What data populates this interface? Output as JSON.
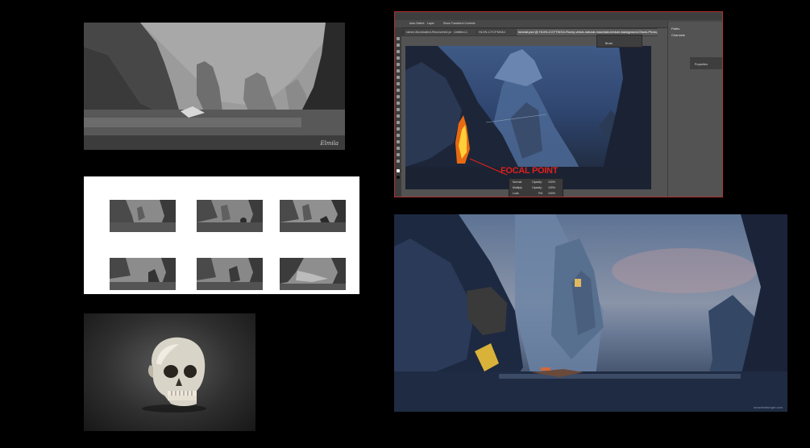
{
  "sketch": {
    "signature": "Elmila"
  },
  "photoshop": {
    "options_bar": [
      "Auto-Select:",
      "Layer",
      "Show Transform Controls"
    ],
    "tabs": [
      "rainer-illuminated-Recovered.psd",
      "Untitled-1",
      "HLVN-CYCFMVA1",
      "tutorial.psd @ HLVN-COYTWG4-Rocky-views-natural-mountain-texture-background-Stock-Photo, RGB/8"
    ],
    "brush_panel_label": "Brush",
    "dock_items": [
      "Paths",
      "Channels"
    ],
    "properties_label": "Properties",
    "focal_point_label": "FOCAL POINT",
    "float_bar": {
      "row1": [
        "Normal",
        "Opacity:",
        "100%"
      ],
      "row2": [
        "Multiply",
        "Opacity:",
        "100%"
      ],
      "row3": [
        "Lock:",
        "Fill:",
        "100%"
      ]
    }
  },
  "painting": {
    "watermark": "arnonfreiberger.com"
  }
}
